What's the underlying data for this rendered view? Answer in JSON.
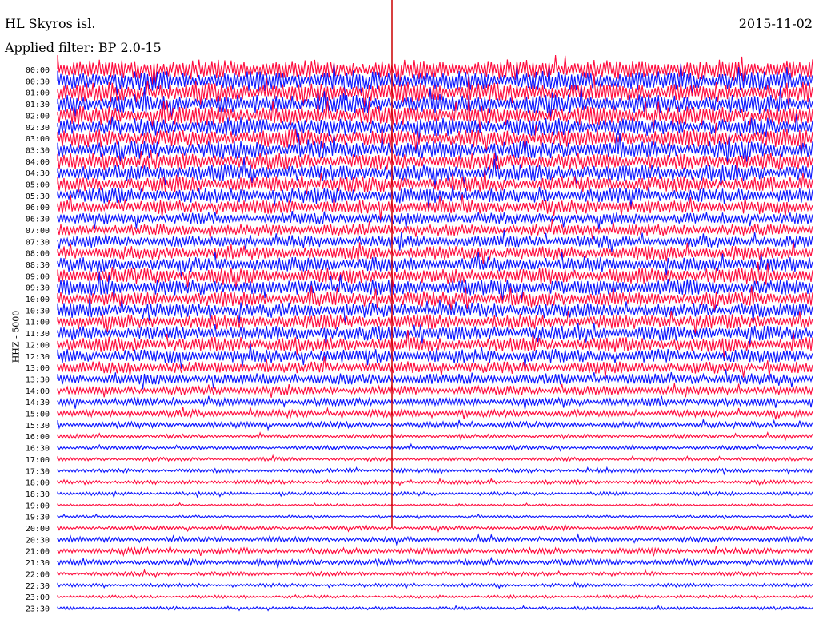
{
  "header": {
    "station": "HL Skyros isl.",
    "date": "2015-11-02",
    "filter": "Applied filter: BP 2.0-15"
  },
  "channel_label": "HHZ - 5000",
  "colors": {
    "trace_a": "#ff0a3c",
    "trace_b": "#0a14ff",
    "marker": "#cc0000"
  },
  "chart_data": {
    "type": "helicorder",
    "title": "HL Skyros isl.",
    "ylabel": "HHZ - 5000",
    "row_labels": [
      "00:00",
      "00:30",
      "01:00",
      "01:30",
      "02:00",
      "02:30",
      "03:00",
      "03:30",
      "04:00",
      "04:30",
      "05:00",
      "05:30",
      "06:00",
      "06:30",
      "07:00",
      "07:30",
      "08:00",
      "08:30",
      "09:00",
      "09:30",
      "10:00",
      "10:30",
      "11:00",
      "11:30",
      "12:00",
      "12:30",
      "13:00",
      "13:30",
      "14:00",
      "14:30",
      "15:00",
      "15:30",
      "16:00",
      "16:30",
      "17:00",
      "17:30",
      "18:00",
      "18:30",
      "19:00",
      "19:30",
      "20:00",
      "20:30",
      "21:00",
      "21:30",
      "22:00",
      "22:30",
      "23:00",
      "23:30"
    ],
    "row_colors_cycle": [
      "red",
      "blue"
    ],
    "relative_amplitude": [
      1.0,
      1.0,
      1.0,
      0.95,
      0.95,
      0.9,
      0.9,
      0.9,
      0.85,
      0.85,
      0.8,
      0.8,
      0.7,
      0.6,
      0.6,
      0.6,
      0.7,
      0.75,
      0.8,
      0.8,
      0.75,
      0.75,
      0.75,
      0.75,
      0.75,
      0.7,
      0.6,
      0.55,
      0.45,
      0.4,
      0.35,
      0.3,
      0.2,
      0.2,
      0.18,
      0.2,
      0.2,
      0.18,
      0.12,
      0.12,
      0.2,
      0.25,
      0.3,
      0.3,
      0.2,
      0.18,
      0.15,
      0.15
    ],
    "marker_minute": 30
  }
}
